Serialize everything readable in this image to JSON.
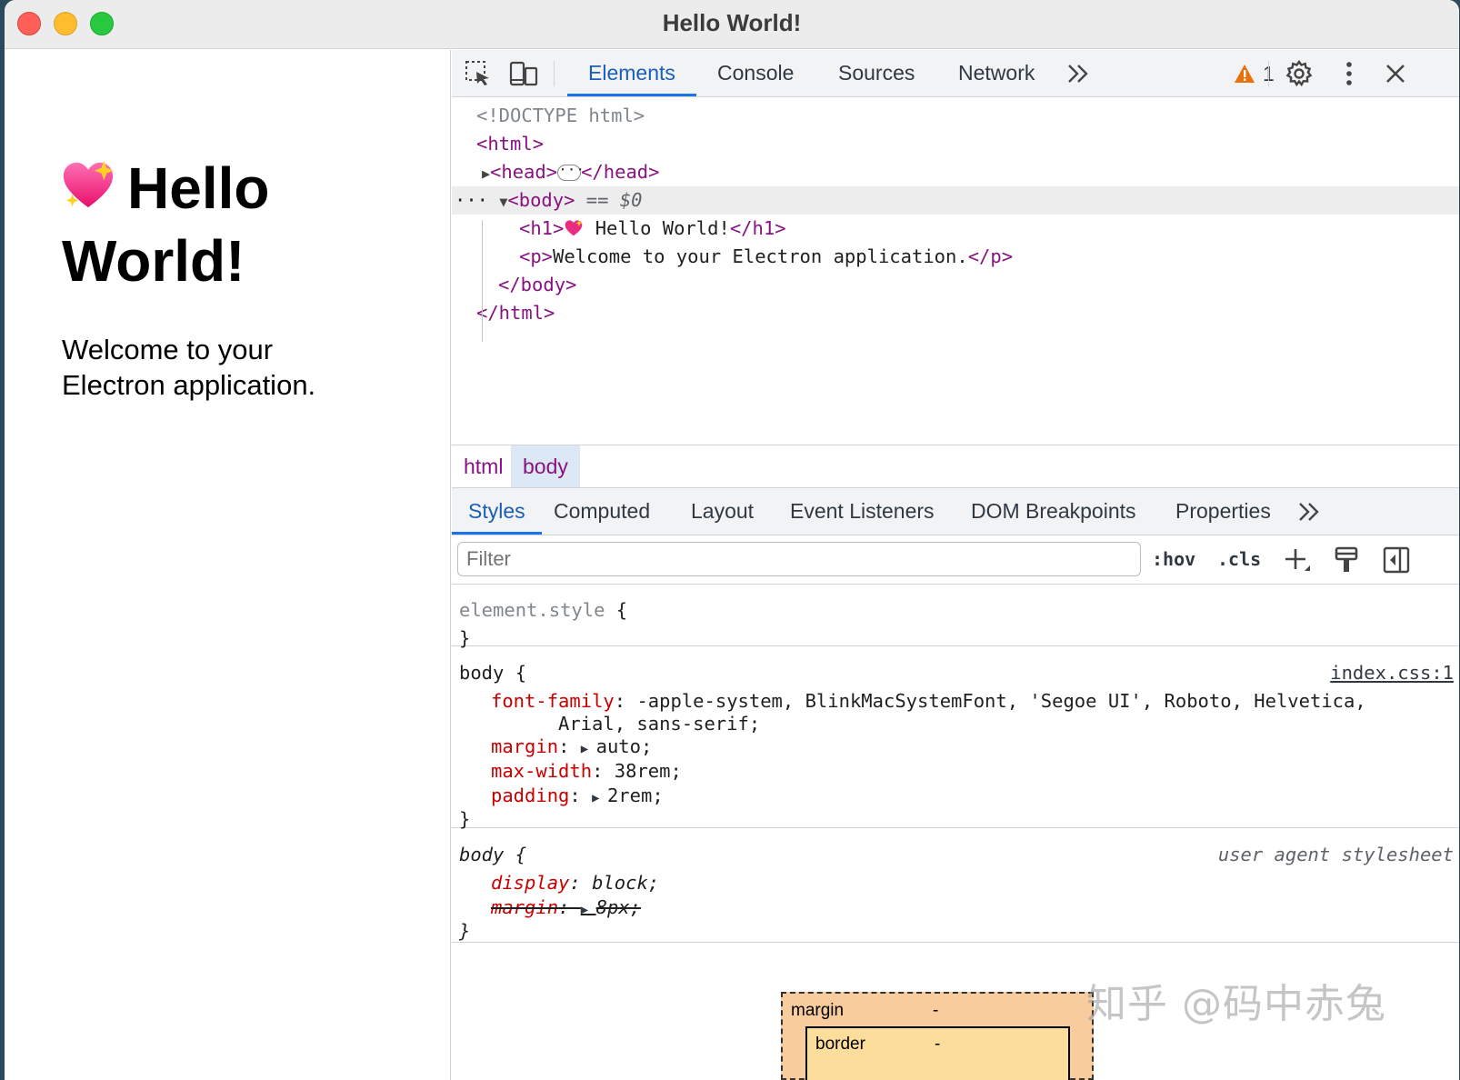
{
  "window": {
    "title": "Hello World!"
  },
  "app": {
    "heading": "Hello World!",
    "paragraph": "Welcome to your Electron application."
  },
  "devtools": {
    "tabs": [
      "Elements",
      "Console",
      "Sources",
      "Network"
    ],
    "warning_count": "1",
    "dom": {
      "doctype": "<!DOCTYPE html>",
      "html_open": "<html>",
      "head_open": "<head>",
      "head_close": "</head>",
      "body_open": "<body>",
      "body_selected": " == $0",
      "h1_open": "<h1>",
      "h1_text": " Hello World!",
      "h1_close": "</h1>",
      "p_open": "<p>",
      "p_text": "Welcome to your Electron application.",
      "p_close": "</p>",
      "body_close": "</body>",
      "html_close": "</html>"
    },
    "breadcrumbs": [
      "html",
      "body"
    ],
    "subtabs": [
      "Styles",
      "Computed",
      "Layout",
      "Event Listeners",
      "DOM Breakpoints",
      "Properties"
    ],
    "filter": {
      "placeholder": "Filter",
      "value": ""
    },
    "filter_buttons": {
      "hov": ":hov",
      "cls": ".cls"
    },
    "rules": {
      "element_style": {
        "selector": "element.style",
        "open": " {",
        "close": "}"
      },
      "body_css": {
        "selector": "body",
        "open": " {",
        "source": "index.css:1",
        "font_family_name": "font-family",
        "font_family_value": "-apple-system, BlinkMacSystemFont, 'Segoe UI', Roboto, Helvetica,",
        "font_family_value_cont": "Arial, sans-serif;",
        "margin_name": "margin",
        "margin_value": "auto;",
        "max_width_name": "max-width",
        "max_width_value": "38rem;",
        "padding_name": "padding",
        "padding_value": "2rem;",
        "close": "}"
      },
      "body_ua": {
        "selector": "body",
        "open": " {",
        "source": "user agent stylesheet",
        "display_name": "display",
        "display_value": "block;",
        "margin_name": "margin",
        "margin_value": "8px;",
        "close": "}"
      }
    },
    "box_model": {
      "margin_label": "margin",
      "margin_value": "-",
      "border_label": "border",
      "border_value": "-"
    }
  },
  "watermark": "知乎 @码中赤兔",
  "colors": {
    "accent": "#1a73e8",
    "tag": "#881280",
    "property": "#c80000",
    "warning": "#e8710a"
  }
}
